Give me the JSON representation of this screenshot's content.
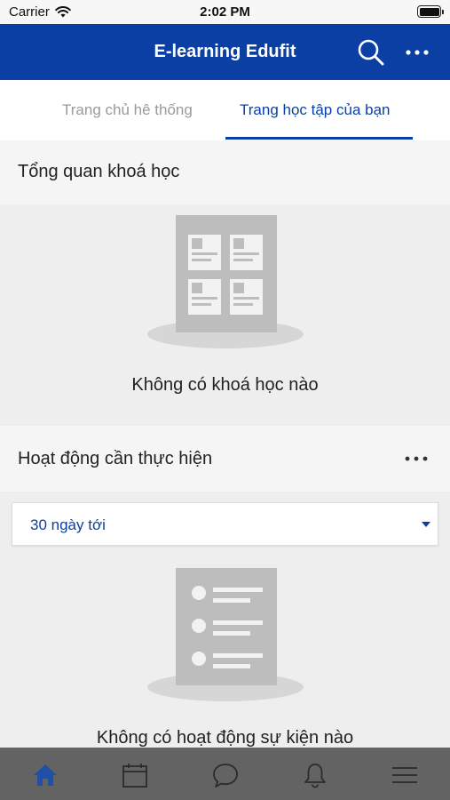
{
  "status_bar": {
    "carrier": "Carrier",
    "time": "2:02 PM"
  },
  "app_bar": {
    "title": "E-learning Edufit"
  },
  "tabs": [
    {
      "label": "Trang chủ hê thống",
      "active": false
    },
    {
      "label": "Trang học tập của bạn",
      "active": true
    }
  ],
  "course_overview": {
    "title": "Tổng quan khoá học",
    "empty_message": "Không có khoá học nào"
  },
  "activities": {
    "title": "Hoạt động cần thực hiện",
    "filter": {
      "selected": "30 ngày tới"
    },
    "empty_message": "Không có hoạt động sự kiện nào"
  },
  "bottom_nav": [
    {
      "icon": "home-icon",
      "active": true
    },
    {
      "icon": "calendar-icon",
      "active": false
    },
    {
      "icon": "chat-icon",
      "active": false
    },
    {
      "icon": "bell-icon",
      "active": false
    },
    {
      "icon": "menu-icon",
      "active": false
    }
  ],
  "colors": {
    "primary": "#0b3fa3",
    "nav_background": "#636363",
    "nav_active": "#1e50a8"
  }
}
